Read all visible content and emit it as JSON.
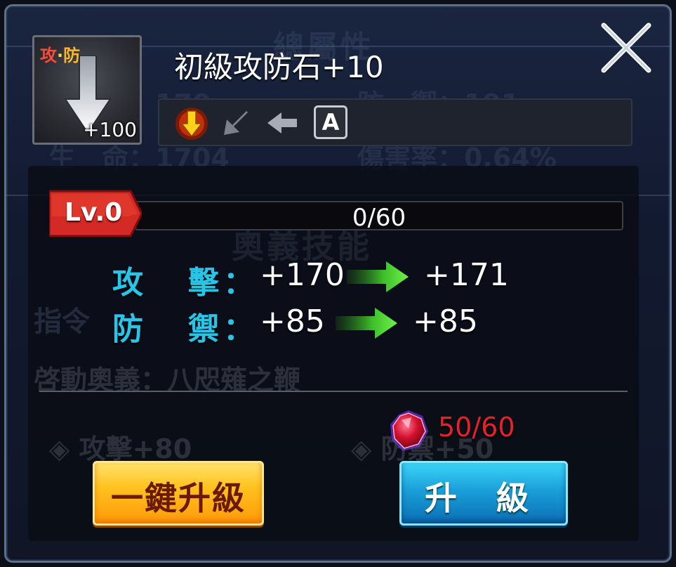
{
  "background": {
    "title": "總屬性",
    "row1_left": "攻　擊：170",
    "row1_right": "防　禦：191",
    "row2_left": "生　命：1704",
    "row2_right": "傷害率：0.64%",
    "skill_title": "奧義技能",
    "command": "指令",
    "activate": "啓動奧義：八咫薙之鞭",
    "bonus_left": "攻擊+80",
    "bonus_right": "防禦+50"
  },
  "item": {
    "name": "初級攻防石+10",
    "tag_atk": "攻",
    "tag_dot": "·",
    "tag_def": "防",
    "count": "+100",
    "icon": "down-arrow-icon"
  },
  "commands": [
    {
      "name": "down-arrow",
      "icon": "down-arrow-icon"
    },
    {
      "name": "down-left-arrow",
      "icon": "down-left-arrow-icon"
    },
    {
      "name": "left-arrow",
      "icon": "left-arrow-icon"
    },
    {
      "name": "a-key",
      "label": "A"
    }
  ],
  "level": {
    "label": "Lv.0",
    "progress_text": "0/60",
    "progress": 0
  },
  "stats": [
    {
      "label_a": "攻",
      "label_b": "擊",
      "colon": "：",
      "current": "+170",
      "next": "+171"
    },
    {
      "label_a": "防",
      "label_b": "禦",
      "colon": "：",
      "current": "+85",
      "next": "+85"
    }
  ],
  "cost": {
    "icon": "red-gem-icon",
    "text": "50/60",
    "color": "#e8202a"
  },
  "buttons": {
    "one_click_upgrade": "一鍵升級",
    "upgrade": "升 級"
  },
  "colors": {
    "stat_label": "#27c6e8",
    "gold_button": "#ffc21e",
    "blue_button": "#1a9fd9",
    "level_badge": "#d42a26"
  }
}
